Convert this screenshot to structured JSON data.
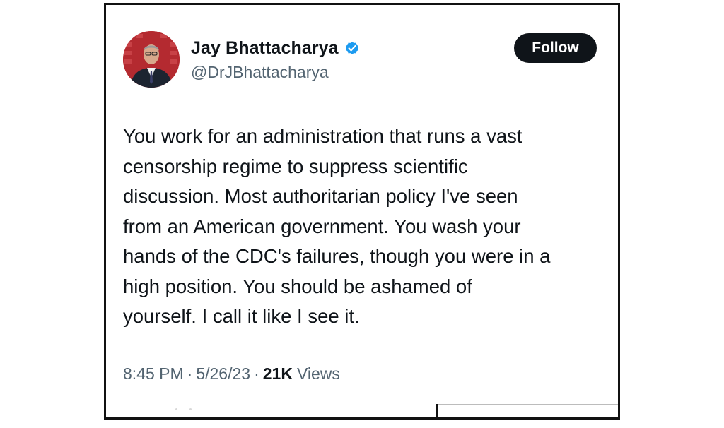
{
  "tweet": {
    "author": {
      "display_name": "Jay Bhattacharya",
      "handle": "@DrJBhattacharya",
      "verified_icon": "verified-badge-icon",
      "avatar_icon": "profile-photo"
    },
    "follow_label": "Follow",
    "text": "You work for an administration that runs a vast\ncensorship regime to suppress scientific\ndiscussion. Most authoritarian policy I've seen\nfrom an American government. You wash your\nhands of the CDC's failures, though you were in a\nhigh position. You should be ashamed of\nyourself. I call it like I see it.",
    "time": "8:45 PM",
    "separator": "·",
    "date": "5/26/23",
    "views_count": "21K",
    "views_label": "Views"
  },
  "colors": {
    "text_primary": "#0f1419",
    "text_secondary": "#536471",
    "verified_blue": "#1d9bf0",
    "follow_bg": "#0f1419",
    "frame_border": "#111111"
  }
}
